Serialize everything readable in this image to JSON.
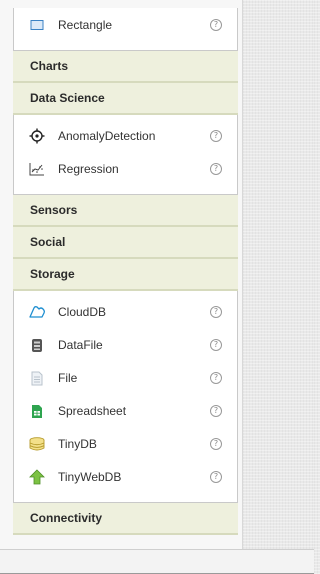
{
  "palette": {
    "top_drawer": {
      "items": [
        {
          "label": "Rectangle",
          "icon": "rectangle-icon",
          "help": "?"
        }
      ]
    },
    "categories": {
      "charts": "Charts",
      "data_science": "Data Science",
      "sensors": "Sensors",
      "social": "Social",
      "storage": "Storage",
      "connectivity": "Connectivity"
    },
    "data_science_items": [
      {
        "label": "AnomalyDetection",
        "icon": "anomaly-detection-icon",
        "help": "?"
      },
      {
        "label": "Regression",
        "icon": "regression-icon",
        "help": "?"
      }
    ],
    "storage_items": [
      {
        "label": "CloudDB",
        "icon": "cloud-icon",
        "help": "?"
      },
      {
        "label": "DataFile",
        "icon": "datafile-icon",
        "help": "?"
      },
      {
        "label": "File",
        "icon": "file-icon",
        "help": "?"
      },
      {
        "label": "Spreadsheet",
        "icon": "spreadsheet-icon",
        "help": "?"
      },
      {
        "label": "TinyDB",
        "icon": "database-icon",
        "help": "?"
      },
      {
        "label": "TinyWebDB",
        "icon": "upload-arrow-icon",
        "help": "?"
      }
    ]
  },
  "colors": {
    "category_bg": "#eef0dd",
    "category_border": "#d6dabd",
    "panel_bg": "#f7f7f7"
  }
}
